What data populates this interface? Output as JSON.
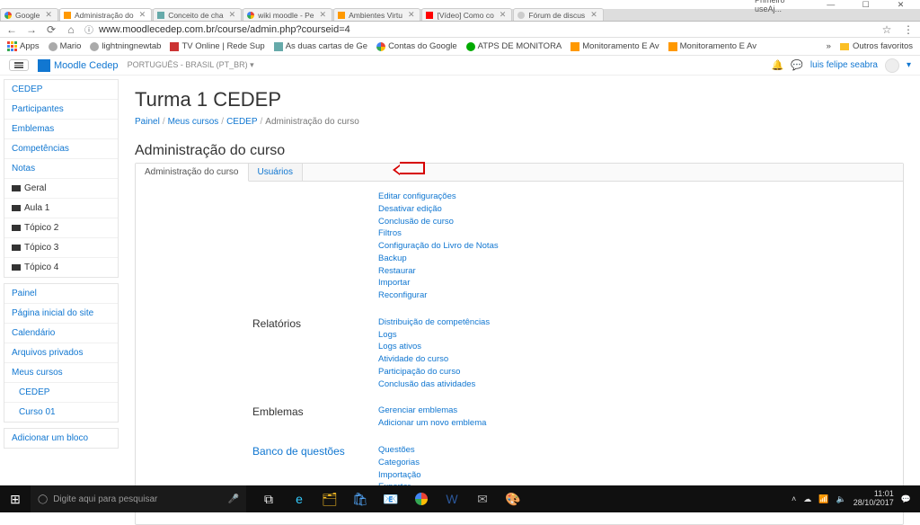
{
  "window": {
    "title_hint": "Primeiro useAj...",
    "min": "—",
    "max": "☐",
    "close": "✕"
  },
  "chrome": {
    "tabs": [
      {
        "label": "Google",
        "fav": "fav-g"
      },
      {
        "label": "Administração do",
        "fav": "fav-m",
        "active": true
      },
      {
        "label": "Conceito de cha",
        "fav": "fav-doc"
      },
      {
        "label": "wiki moodle - Pe",
        "fav": "fav-g"
      },
      {
        "label": "Ambientes Virtu",
        "fav": "fav-m"
      },
      {
        "label": "[Vídeo] Como co",
        "fav": "fav-yt"
      },
      {
        "label": "Fórum de discus",
        "fav": "fav-w"
      }
    ],
    "nav": {
      "back": "←",
      "forward": "→",
      "reload": "⟳",
      "home": "⌂"
    },
    "lock": "ⓘ",
    "url": "www.moodlecedep.com.br/course/admin.php?courseid=4",
    "right_icons": {
      "bookmark": "",
      "star": "☆",
      "user": "",
      "menu": "⋮"
    },
    "bookmarks": {
      "apps_label": "Apps",
      "items": [
        {
          "label": "Mario",
          "fav": "fav-gray"
        },
        {
          "label": "lightningnewtab",
          "fav": "fav-gray"
        },
        {
          "label": "TV Online | Rede Sup",
          "fav": "fav-tv"
        },
        {
          "label": "As duas cartas de Ge",
          "fav": "fav-doc"
        },
        {
          "label": "Contas do Google",
          "fav": "fav-g"
        },
        {
          "label": "ATPS DE MONITORA",
          "fav": "fav-green"
        },
        {
          "label": "Monitoramento E Av",
          "fav": "fav-m"
        },
        {
          "label": "Monitoramento E Av",
          "fav": "fav-m"
        }
      ],
      "more": "»",
      "other": "Outros favoritos"
    }
  },
  "moodle": {
    "brand": "Moodle Cedep",
    "lang": "PORTUGUÊS - BRASIL (PT_BR) ▾",
    "notif_bell": "🔔",
    "notif_msg": "💬",
    "username": "luis felipe seabra",
    "caret": "▾"
  },
  "sidebar": {
    "block1": [
      {
        "label": "CEDEP"
      },
      {
        "label": "Participantes"
      },
      {
        "label": "Emblemas"
      },
      {
        "label": "Competências"
      },
      {
        "label": "Notas"
      },
      {
        "label": "Geral",
        "folder": true
      },
      {
        "label": "Aula 1",
        "folder": true
      },
      {
        "label": "Tópico 2",
        "folder": true
      },
      {
        "label": "Tópico 3",
        "folder": true
      },
      {
        "label": "Tópico 4",
        "folder": true
      }
    ],
    "block2": [
      {
        "label": "Painel"
      },
      {
        "label": "Página inicial do site"
      },
      {
        "label": "Calendário"
      },
      {
        "label": "Arquivos privados"
      },
      {
        "label": "Meus cursos"
      },
      {
        "label": "CEDEP",
        "indent": true
      },
      {
        "label": "Curso 01",
        "indent": true
      }
    ],
    "block3": [
      {
        "label": "Adicionar um bloco"
      }
    ]
  },
  "page": {
    "title": "Turma 1 CEDEP",
    "crumbs": [
      "Painel",
      "Meus cursos",
      "CEDEP",
      "Administração do curso"
    ],
    "admin_heading": "Administração do curso",
    "tabs": [
      {
        "label": "Administração do curso",
        "active": true
      },
      {
        "label": "Usuários",
        "link": true
      }
    ],
    "sections": [
      {
        "label": "",
        "links": [
          "Editar configurações",
          "Desativar edição",
          "Conclusão de curso",
          "Filtros",
          "Configuração do Livro de Notas",
          "Backup",
          "Restaurar",
          "Importar",
          "Reconfigurar"
        ]
      },
      {
        "label": "Relatórios",
        "links": [
          "Distribuição de competências",
          "Logs",
          "Logs ativos",
          "Atividade do curso",
          "Participação do curso",
          "Conclusão das atividades"
        ]
      },
      {
        "label": "Emblemas",
        "links": [
          "Gerenciar emblemas",
          "Adicionar um novo emblema"
        ]
      },
      {
        "label": "Banco de questões",
        "link_label": true,
        "links": [
          "Questões",
          "Categorias",
          "Importação",
          "Exportar"
        ]
      }
    ]
  },
  "taskbar": {
    "search_placeholder": "Digite aqui para pesquisar",
    "time": "11:01",
    "date": "28/10/2017"
  }
}
